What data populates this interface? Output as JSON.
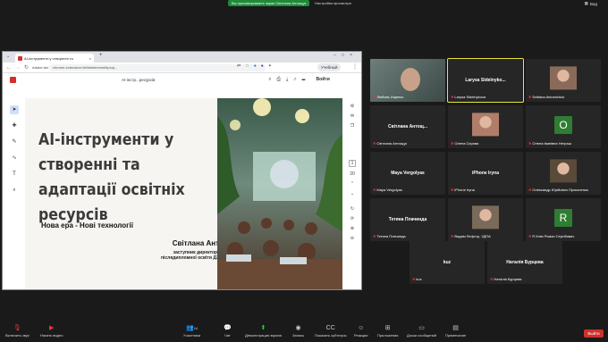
{
  "meeting": {
    "banner_text": "Вы просматриваете экран Світлана Антощук",
    "settings_label": "Настройки просмотра",
    "view_label": "Вид"
  },
  "browser": {
    "tab_title": "AI-інструменти у створенні та",
    "tab_new": "+",
    "site_label": "Adobe Acr",
    "url": "chrome-extension://efaidnbmnnnibpcaj...",
    "profile_label": "Учебный",
    "pdf_title": "AI-інстр...ресурсів",
    "sign_in": "Войти",
    "page_number": "1",
    "page_count": "20"
  },
  "slide": {
    "title": "AI-інструменти у створенні та адаптації освітніх ресурсів",
    "subtitle": "Нова ера - Нові технології",
    "author": "Світлана Антощук",
    "position": "заступник директора Центру післядипломної освіти ДЗВО УМО"
  },
  "participants": [
    {
      "name": "Любовь Ищенко",
      "center": "",
      "type": "video"
    },
    {
      "name": "Larysa Sidelnykova",
      "center": "Larysa Sidelnyko...",
      "type": "name",
      "active": true
    },
    {
      "name": "Svitlana Antoshchuk",
      "center": "",
      "type": "photo"
    },
    {
      "name": "Світлана Антощук",
      "center": "Світлана Антощ...",
      "type": "name"
    },
    {
      "name": "Олена Сєрова",
      "center": "",
      "type": "photo"
    },
    {
      "name": "Олена Іванівна Неграш",
      "center": "O",
      "type": "letter"
    },
    {
      "name": "Maya Vergolyas",
      "center": "Maya Vergolyas",
      "type": "name"
    },
    {
      "name": "iPhone Iryna",
      "center": "iPhone Iryna",
      "type": "name"
    },
    {
      "name": "Олександр Юрійович Прокопенко",
      "center": "",
      "type": "photo"
    },
    {
      "name": "Тетяна Плачинда",
      "center": "Тетяна Плачинда",
      "type": "name"
    },
    {
      "name": "Вадим Лефтор, УДПА",
      "center": "",
      "type": "photo"
    },
    {
      "name": "R Клім Роман Сергійович",
      "center": "R",
      "type": "letter"
    },
    {
      "name": "kuz",
      "center": "kuz",
      "type": "name"
    },
    {
      "name": "Наталія Бурцева",
      "center": "Наталія Бурцева",
      "type": "name"
    }
  ],
  "toolbar": {
    "audio": "Включить звук",
    "video": "Начать видео",
    "participants": "Участники",
    "participants_count": "14",
    "chat": "Чат",
    "share": "Демонстрация экрана",
    "record": "Запись",
    "captions": "Показать субтитры",
    "reactions": "Реакции",
    "apps": "Приложения",
    "whiteboards": "Доски сообщений",
    "notes": "Примечание",
    "leave": "Выйти"
  },
  "colors": {
    "accent_green": "#1f8a3a",
    "leave_red": "#d0312d",
    "active_tile": "#e6e63c"
  }
}
